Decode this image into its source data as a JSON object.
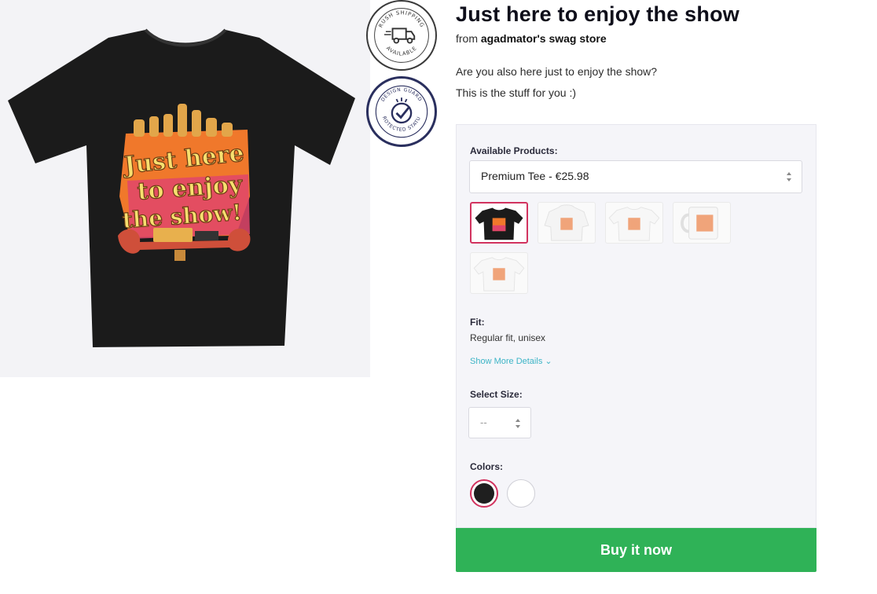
{
  "product": {
    "title": "Just here to enjoy the show",
    "from_prefix": "from",
    "store": "agadmator's swag store",
    "description": [
      "Are you also here just to enjoy the show?",
      "This is the stuff for you :)"
    ]
  },
  "design_text": [
    "Just here",
    "to enjoy",
    "the show!"
  ],
  "badges": {
    "rush": [
      "RUSH SHIPPING",
      "AVAILABLE"
    ],
    "guard": [
      "DESIGN GUARD",
      "PROTECTED STATUS"
    ]
  },
  "options": {
    "products_label": "Available Products:",
    "selected_product": "Premium Tee - €25.98",
    "thumbnails": [
      {
        "name": "premium-tee-black",
        "selected": true
      },
      {
        "name": "hoodie-white",
        "selected": false
      },
      {
        "name": "tee-white",
        "selected": false
      },
      {
        "name": "mug-white",
        "selected": false
      },
      {
        "name": "kids-tee-white",
        "selected": false
      }
    ],
    "fit_label": "Fit:",
    "fit_value": "Regular fit, unisex",
    "show_more": "Show More Details",
    "size_label": "Select Size:",
    "size_value": "--",
    "colors_label": "Colors:",
    "colors": [
      {
        "name": "black",
        "hex": "#1f1f1f",
        "selected": true
      },
      {
        "name": "white",
        "hex": "#ffffff",
        "selected": false
      }
    ]
  },
  "cta": {
    "buy_label": "Buy it now",
    "color": "#2fb257"
  },
  "accent": "#d2335f"
}
